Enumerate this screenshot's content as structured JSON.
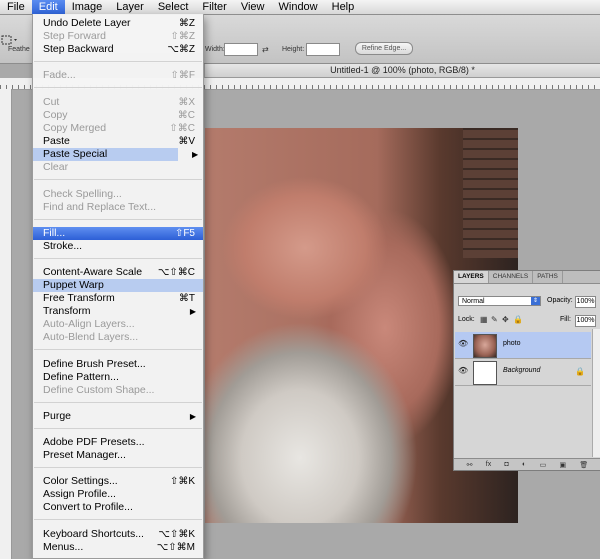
{
  "menubar": {
    "items": [
      "File",
      "Edit",
      "Image",
      "Layer",
      "Select",
      "Filter",
      "View",
      "Window",
      "Help"
    ]
  },
  "options_bar": {
    "feather_label": "Feathe",
    "width_label": "Width:",
    "height_label": "Height:",
    "refine_edge": "Refine Edge..."
  },
  "document": {
    "title": "Untitled-1 @ 100% (photo, RGB/8) *"
  },
  "edit_menu": {
    "items": [
      {
        "label": "Undo Delete Layer",
        "shortcut": "⌘Z",
        "enabled": true
      },
      {
        "label": "Step Forward",
        "shortcut": "⇧⌘Z",
        "enabled": false
      },
      {
        "label": "Step Backward",
        "shortcut": "⌥⌘Z",
        "enabled": true
      },
      {
        "label": "Fade...",
        "shortcut": "⇧⌘F",
        "enabled": false
      },
      {
        "label": "Cut",
        "shortcut": "⌘X",
        "enabled": false
      },
      {
        "label": "Copy",
        "shortcut": "⌘C",
        "enabled": false
      },
      {
        "label": "Copy Merged",
        "shortcut": "⇧⌘C",
        "enabled": false
      },
      {
        "label": "Paste",
        "shortcut": "⌘V",
        "enabled": true
      },
      {
        "label": "Paste Special",
        "shortcut": "",
        "enabled": true,
        "submenu": true
      },
      {
        "label": "Clear",
        "shortcut": "",
        "enabled": false
      },
      {
        "label": "Check Spelling...",
        "shortcut": "",
        "enabled": false
      },
      {
        "label": "Find and Replace Text...",
        "shortcut": "",
        "enabled": false
      },
      {
        "label": "Fill...",
        "shortcut": "⇧F5",
        "enabled": true
      },
      {
        "label": "Stroke...",
        "shortcut": "",
        "enabled": true
      },
      {
        "label": "Content-Aware Scale",
        "shortcut": "⌥⇧⌘C",
        "enabled": true
      },
      {
        "label": "Puppet Warp",
        "shortcut": "",
        "enabled": true
      },
      {
        "label": "Free Transform",
        "shortcut": "⌘T",
        "enabled": true
      },
      {
        "label": "Transform",
        "shortcut": "",
        "enabled": true,
        "submenu": true
      },
      {
        "label": "Auto-Align Layers...",
        "shortcut": "",
        "enabled": false
      },
      {
        "label": "Auto-Blend Layers...",
        "shortcut": "",
        "enabled": false
      },
      {
        "label": "Define Brush Preset...",
        "shortcut": "",
        "enabled": true
      },
      {
        "label": "Define Pattern...",
        "shortcut": "",
        "enabled": true
      },
      {
        "label": "Define Custom Shape...",
        "shortcut": "",
        "enabled": false
      },
      {
        "label": "Purge",
        "shortcut": "",
        "enabled": true,
        "submenu": true
      },
      {
        "label": "Adobe PDF Presets...",
        "shortcut": "",
        "enabled": true
      },
      {
        "label": "Preset Manager...",
        "shortcut": "",
        "enabled": true
      },
      {
        "label": "Color Settings...",
        "shortcut": "⇧⌘K",
        "enabled": true
      },
      {
        "label": "Assign Profile...",
        "shortcut": "",
        "enabled": true
      },
      {
        "label": "Convert to Profile...",
        "shortcut": "",
        "enabled": true
      },
      {
        "label": "Keyboard Shortcuts...",
        "shortcut": "⌥⇧⌘K",
        "enabled": true
      },
      {
        "label": "Menus...",
        "shortcut": "⌥⇧⌘M",
        "enabled": true
      }
    ],
    "highlighted": "Fill...",
    "hover": "Puppet Warp"
  },
  "layers_panel": {
    "tabs": [
      "LAYERS",
      "CHANNELS",
      "PATHS"
    ],
    "blend_mode": "Normal",
    "opacity_label": "Opacity:",
    "opacity": "100%",
    "lock_label": "Lock:",
    "fill_label": "Fill:",
    "fill": "100%",
    "layers": [
      {
        "name": "photo",
        "selected": true
      },
      {
        "name": "Background",
        "selected": false,
        "locked": true
      }
    ]
  },
  "icons": {
    "eye": "eye-icon",
    "lock": "lock-icon",
    "submenu": "chevron-right-icon"
  },
  "colors": {
    "menu_highlight": "#2d5fd6",
    "selected_layer": "#b5c9f2"
  }
}
